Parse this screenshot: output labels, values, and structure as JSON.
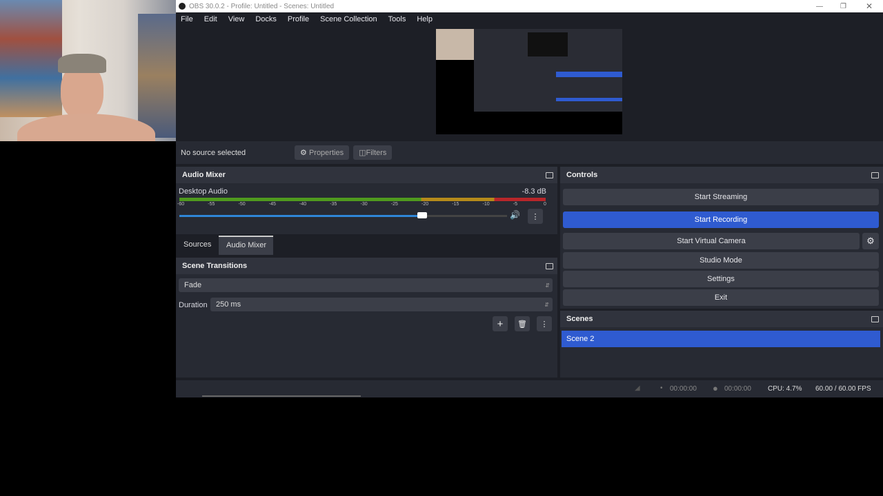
{
  "window": {
    "title": "OBS 30.0.2 - Profile: Untitled - Scenes: Untitled",
    "controls": [
      "minimize",
      "restore",
      "close"
    ]
  },
  "menu": [
    "File",
    "Edit",
    "View",
    "Docks",
    "Profile",
    "Scene Collection",
    "Tools",
    "Help"
  ],
  "source_toolbar": {
    "status": "No source selected",
    "properties": "Properties",
    "filters": "Filters"
  },
  "audio_mixer": {
    "title": "Audio Mixer",
    "channel": {
      "name": "Desktop Audio",
      "level": "-8.3 dB",
      "ticks": [
        "-60",
        "-55",
        "-50",
        "-45",
        "-40",
        "-35",
        "-30",
        "-25",
        "-20",
        "-15",
        "-10",
        "-5",
        "0"
      ],
      "volume_fraction": 0.74
    }
  },
  "tabs": {
    "sources": "Sources",
    "audio_mixer": "Audio Mixer",
    "active": "Audio Mixer"
  },
  "transitions": {
    "title": "Scene Transitions",
    "type": "Fade",
    "duration_label": "Duration",
    "duration": "250 ms"
  },
  "controls": {
    "title": "Controls",
    "start_streaming": "Start Streaming",
    "start_recording": "Start Recording",
    "start_virtual_camera": "Start Virtual Camera",
    "studio_mode": "Studio Mode",
    "settings": "Settings",
    "exit": "Exit"
  },
  "scenes": {
    "title": "Scenes",
    "items": [
      "Scene 2"
    ]
  },
  "status": {
    "stream_time": "00:00:00",
    "record_time": "00:00:00",
    "cpu": "CPU: 4.7%",
    "fps": "60.00 / 60.00 FPS"
  },
  "colors": {
    "accent": "#2f5bd0",
    "meter_green": "#4f9a1e",
    "meter_yellow": "#b58a1a",
    "meter_red": "#b8262a",
    "slider": "#2f86d8"
  }
}
